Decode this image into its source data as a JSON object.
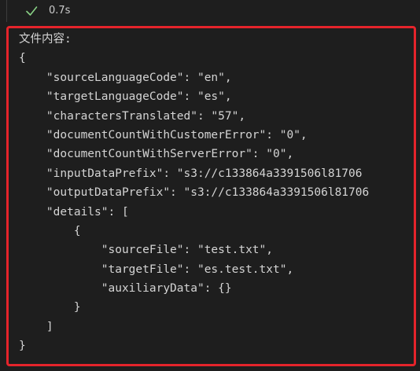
{
  "status": {
    "icon": "check-icon",
    "time": "0.7s"
  },
  "output": {
    "header": "文件内容:",
    "lines": [
      "{",
      "    \"sourceLanguageCode\": \"en\",",
      "    \"targetLanguageCode\": \"es\",",
      "    \"charactersTranslated\": \"57\",",
      "    \"documentCountWithCustomerError\": \"0\",",
      "    \"documentCountWithServerError\": \"0\",",
      "    \"inputDataPrefix\": \"s3://c133864a3391506l81706",
      "    \"outputDataPrefix\": \"s3://c133864a3391506l81706",
      "    \"details\": [",
      "        {",
      "            \"sourceFile\": \"test.txt\",",
      "            \"targetFile\": \"es.test.txt\",",
      "            \"auxiliaryData\": {}",
      "        }",
      "    ]",
      "}"
    ]
  },
  "colors": {
    "background": "#1e1e1e",
    "text": "#d4d4d4",
    "check": "#89d185",
    "highlight": "#e5242b"
  }
}
